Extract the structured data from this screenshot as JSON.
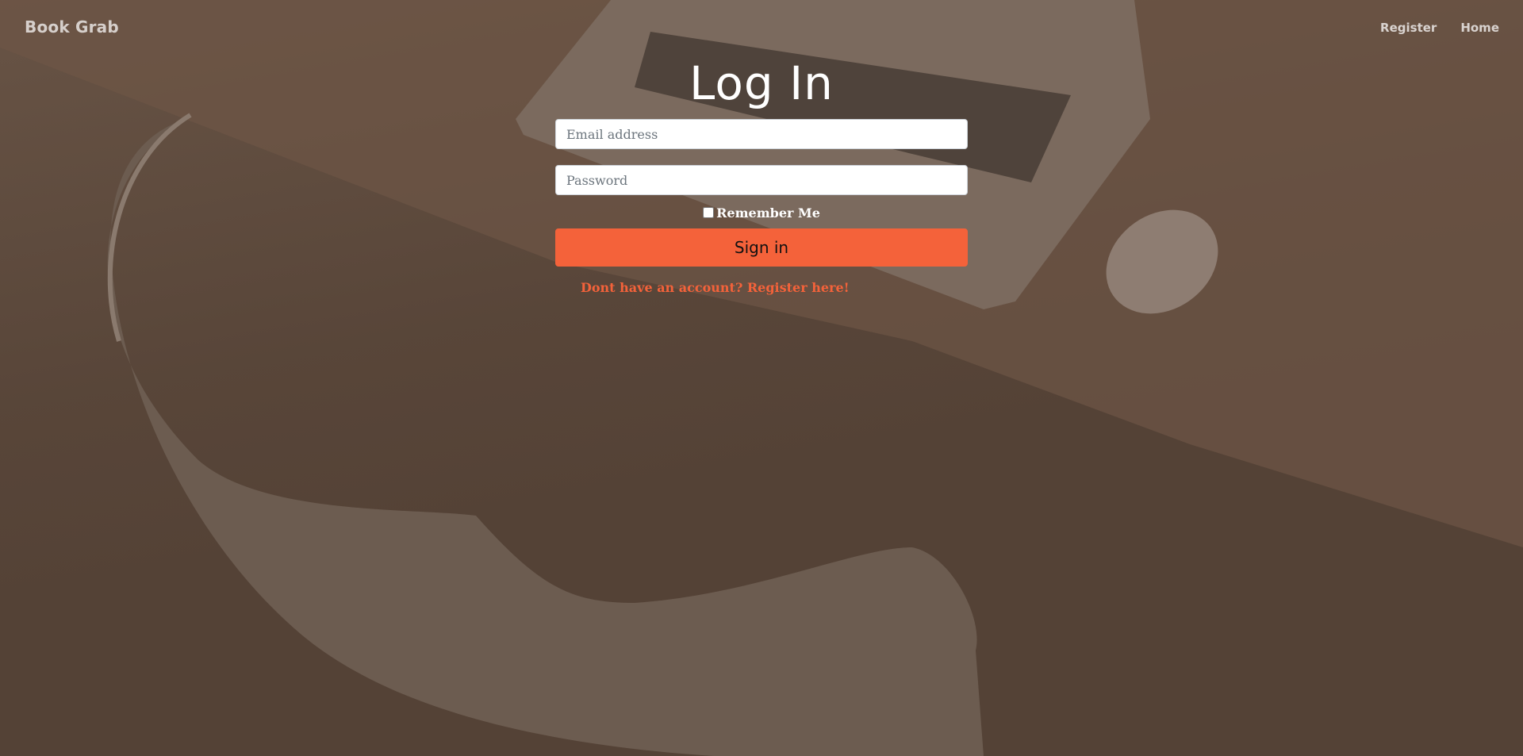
{
  "navbar": {
    "brand": "Book Grab",
    "links": [
      {
        "label": "Register"
      },
      {
        "label": "Home"
      }
    ]
  },
  "login": {
    "title": "Log In",
    "email_placeholder": "Email address",
    "password_placeholder": "Password",
    "remember_label": "Remember Me",
    "remember_checked": false,
    "submit_label": "Sign in",
    "register_link": "Dont have an account? Register here!"
  },
  "colors": {
    "accent": "#f4623a",
    "background": "#544236"
  }
}
